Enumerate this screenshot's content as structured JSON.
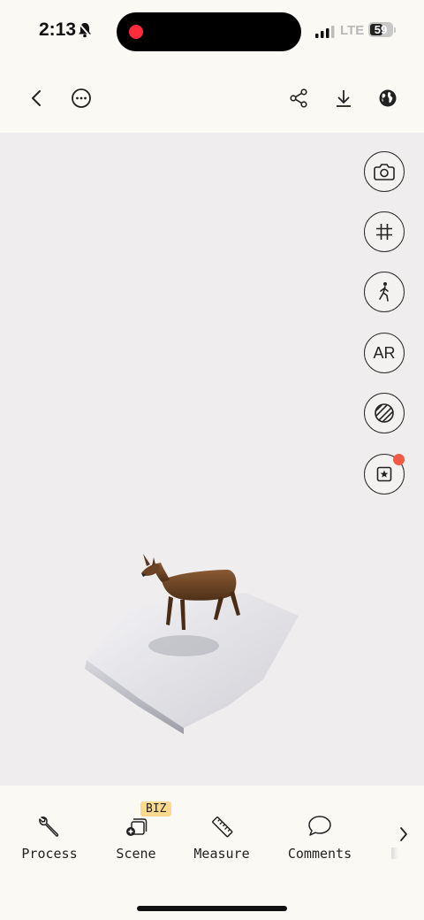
{
  "status_bar": {
    "time": "2:13",
    "network": "LTE",
    "battery": "59",
    "battery_level": 0.59
  },
  "top_bar": {
    "icons": [
      "chevron-left-icon",
      "more-options-icon",
      "share-icon",
      "download-icon",
      "globe-icon"
    ]
  },
  "side_tools": {
    "ar_label": "AR",
    "icons": [
      "camera-icon",
      "grid-icon",
      "walk-icon",
      "ar-button",
      "texture-icon",
      "bookmark-star-icon"
    ],
    "notification_color": "#f25a45"
  },
  "bottom_tabs": {
    "items": [
      {
        "label": "Process",
        "icon": "wrench-icon"
      },
      {
        "label": "Scene",
        "icon": "scene-icon",
        "badge": "BIZ"
      },
      {
        "label": "Measure",
        "icon": "ruler-icon"
      },
      {
        "label": "Comments",
        "icon": "comment-icon"
      }
    ],
    "badge_color": "#fbd98f"
  }
}
